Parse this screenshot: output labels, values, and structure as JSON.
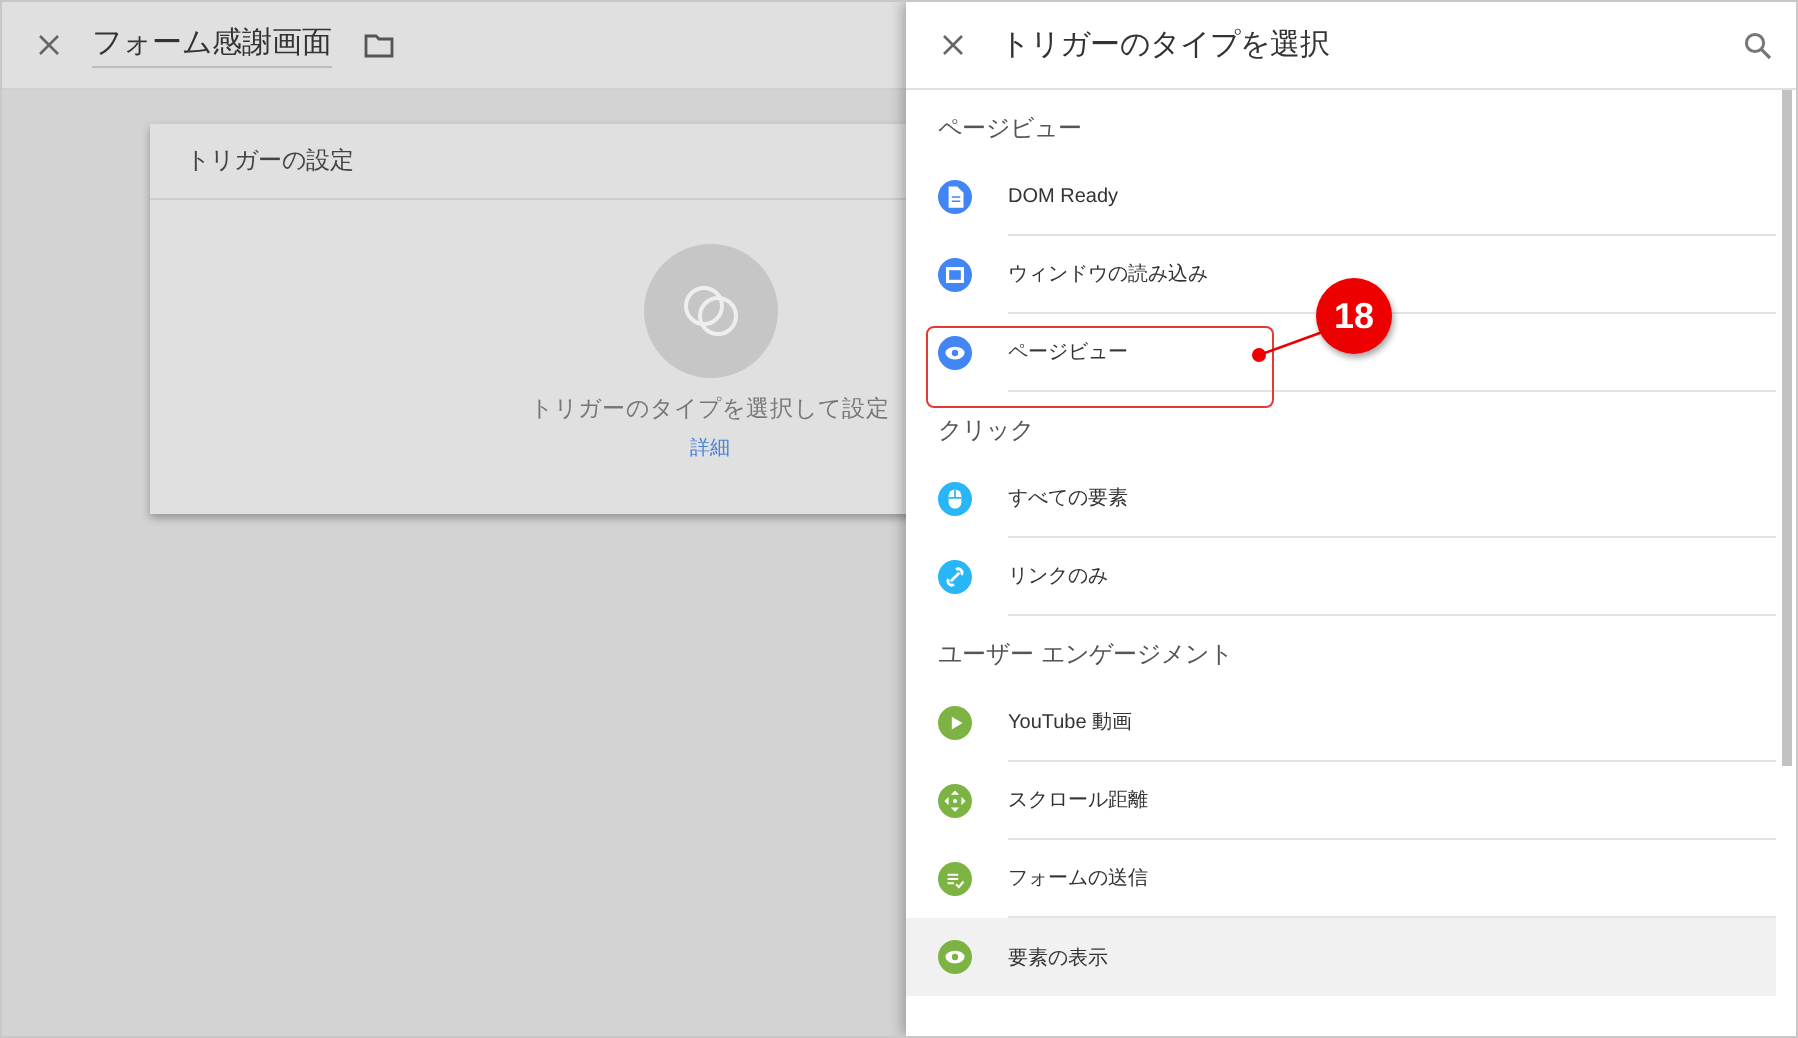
{
  "editor": {
    "title": "フォーム感謝画面",
    "card_title": "トリガーの設定",
    "hint": "トリガーのタイプを選択して設定",
    "link": "詳細"
  },
  "panel": {
    "title": "トリガーのタイプを選択",
    "sections": [
      {
        "heading": "ページビュー",
        "items": [
          {
            "label": "DOM Ready",
            "kind": "document",
            "color": "#4285f4",
            "highlighted": false
          },
          {
            "label": "ウィンドウの読み込み",
            "kind": "window",
            "color": "#4285f4",
            "highlighted": false
          },
          {
            "label": "ページビュー",
            "kind": "eye",
            "color": "#4285f4",
            "highlighted": false
          }
        ]
      },
      {
        "heading": "クリック",
        "items": [
          {
            "label": "すべての要素",
            "kind": "mouse",
            "color": "#29b6f6",
            "highlighted": false
          },
          {
            "label": "リンクのみ",
            "kind": "link",
            "color": "#29b6f6",
            "highlighted": false
          }
        ]
      },
      {
        "heading": "ユーザー エンゲージメント",
        "items": [
          {
            "label": "YouTube 動画",
            "kind": "play",
            "color": "#7cb342",
            "highlighted": false
          },
          {
            "label": "スクロール距離",
            "kind": "move",
            "color": "#7cb342",
            "highlighted": false
          },
          {
            "label": "フォームの送信",
            "kind": "form",
            "color": "#7cb342",
            "highlighted": false
          },
          {
            "label": "要素の表示",
            "kind": "eye",
            "color": "#7cb342",
            "highlighted": true
          }
        ]
      }
    ]
  },
  "annotation": {
    "number": "18"
  }
}
